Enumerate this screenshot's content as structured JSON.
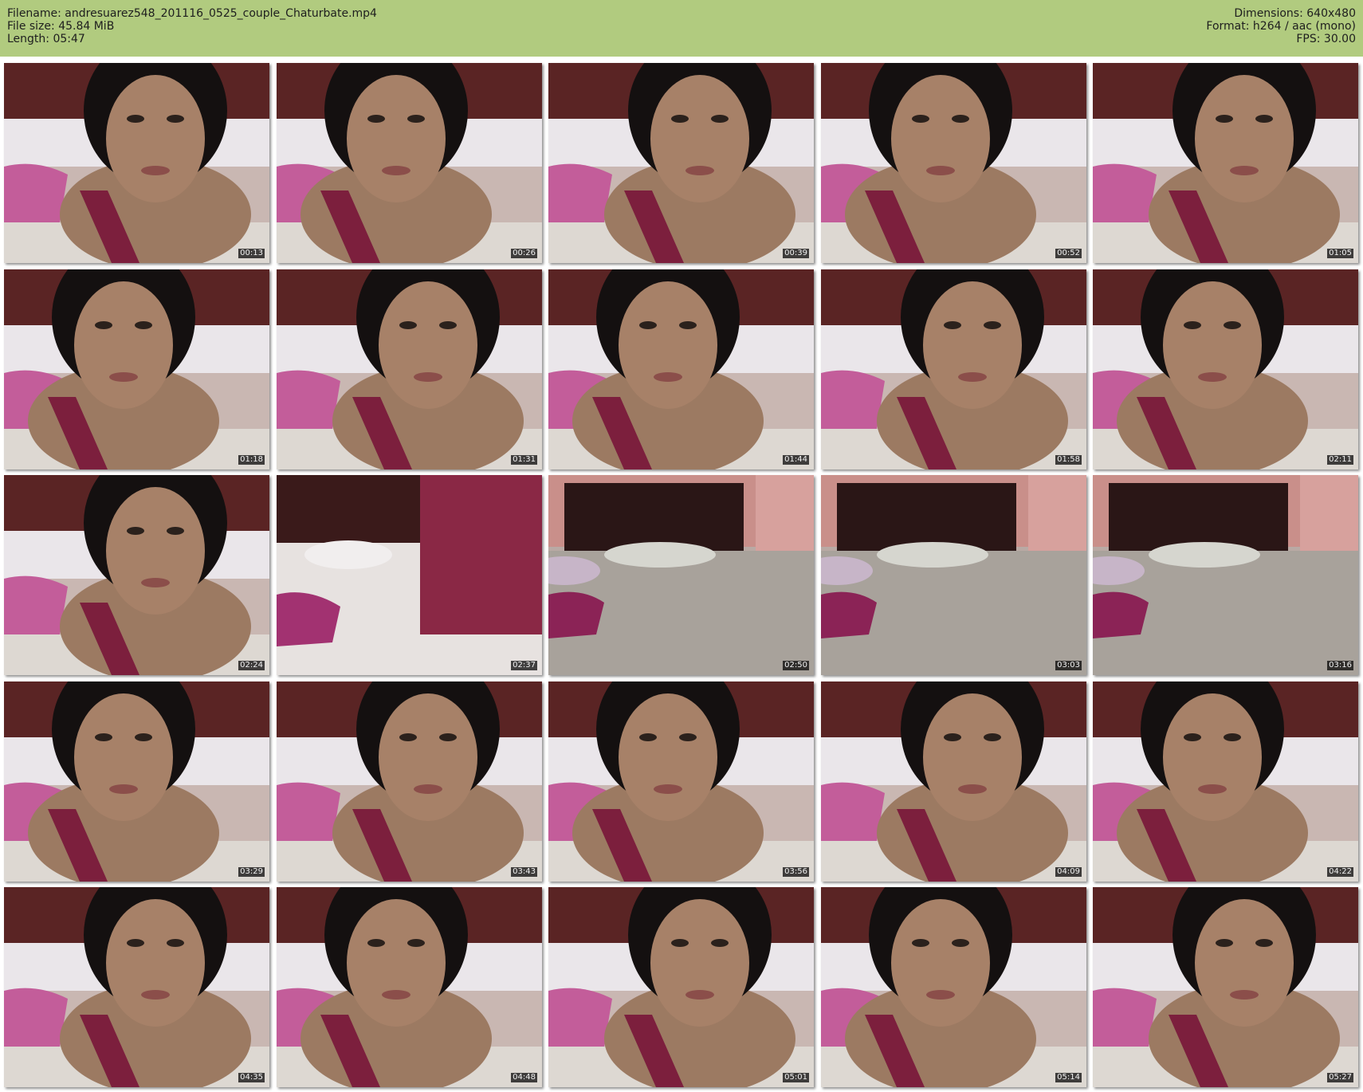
{
  "header": {
    "filename_label": "Filename: andresuarez548_201116_0525_couple_Chaturbate.mp4",
    "filesize_label": "File size: 45.84 MiB",
    "length_label": "Length: 05:47",
    "dimensions_label": "Dimensions: 640x480",
    "format_label": "Format: h264 / aac (mono)",
    "fps_label": "FPS: 30.00",
    "background_color": "#b1cb7f"
  },
  "thumbnails": [
    {
      "timestamp": "00:13",
      "scene": "woman-closeup"
    },
    {
      "timestamp": "00:26",
      "scene": "woman-closeup"
    },
    {
      "timestamp": "00:39",
      "scene": "woman-closeup"
    },
    {
      "timestamp": "00:52",
      "scene": "woman-closeup"
    },
    {
      "timestamp": "01:05",
      "scene": "woman-closeup"
    },
    {
      "timestamp": "01:18",
      "scene": "woman-closeup"
    },
    {
      "timestamp": "01:31",
      "scene": "woman-closeup"
    },
    {
      "timestamp": "01:44",
      "scene": "woman-closeup"
    },
    {
      "timestamp": "01:58",
      "scene": "woman-closeup"
    },
    {
      "timestamp": "02:11",
      "scene": "woman-closeup"
    },
    {
      "timestamp": "02:24",
      "scene": "woman-closeup"
    },
    {
      "timestamp": "02:37",
      "scene": "bed-motion"
    },
    {
      "timestamp": "02:50",
      "scene": "empty-bed"
    },
    {
      "timestamp": "03:03",
      "scene": "empty-bed"
    },
    {
      "timestamp": "03:16",
      "scene": "empty-bed"
    },
    {
      "timestamp": "03:29",
      "scene": "woman-closeup"
    },
    {
      "timestamp": "03:43",
      "scene": "woman-closeup"
    },
    {
      "timestamp": "03:56",
      "scene": "woman-closeup"
    },
    {
      "timestamp": "04:09",
      "scene": "woman-closeup"
    },
    {
      "timestamp": "04:22",
      "scene": "woman-closeup"
    },
    {
      "timestamp": "04:35",
      "scene": "woman-closeup"
    },
    {
      "timestamp": "04:48",
      "scene": "woman-closeup"
    },
    {
      "timestamp": "05:01",
      "scene": "woman-closeup"
    },
    {
      "timestamp": "05:14",
      "scene": "woman-closeup"
    },
    {
      "timestamp": "05:27",
      "scene": "woman-closeup"
    }
  ]
}
